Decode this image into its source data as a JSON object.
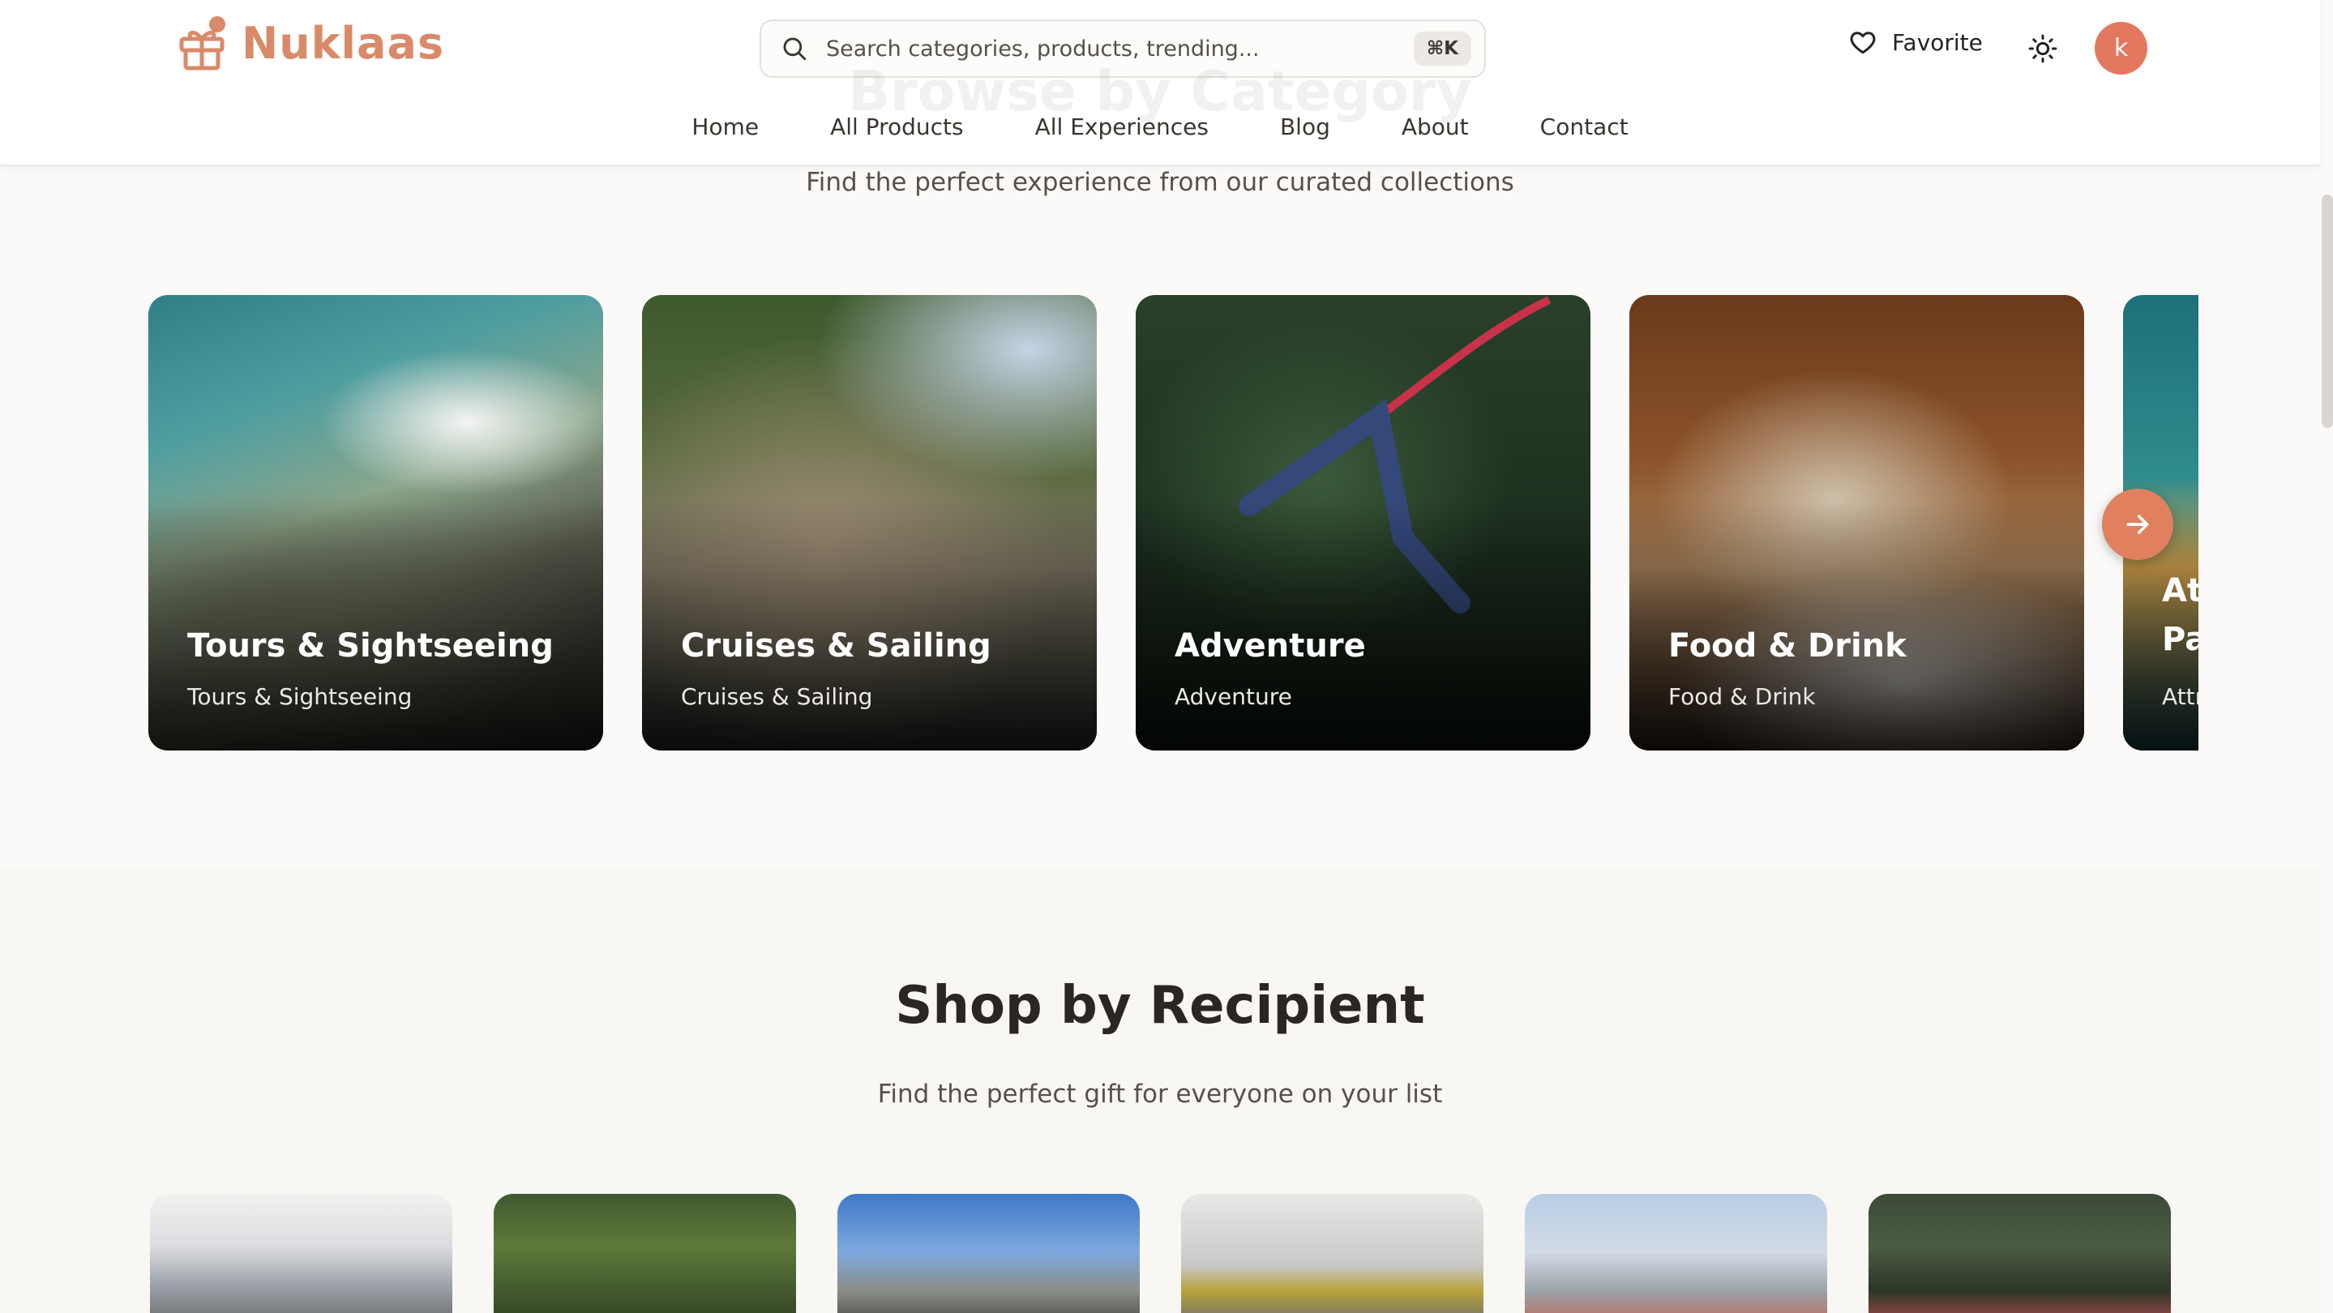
{
  "header": {
    "brand": "Nuklaas",
    "search_placeholder": "Search categories, products, trending...",
    "search_shortcut": "⌘K",
    "favorite_label": "Favorite",
    "avatar_initial": "k",
    "nav": [
      "Home",
      "All Products",
      "All Experiences",
      "Blog",
      "About",
      "Contact"
    ]
  },
  "categories_section": {
    "heading_partial": "Browse by Category",
    "subtitle": "Find the perfect experience from our curated collections",
    "cards": [
      {
        "title": "Tours & Sightseeing",
        "subtitle": "Tours & Sightseeing",
        "image": "helicopter-cockpit-over-coast"
      },
      {
        "title": "Cruises & Sailing",
        "subtitle": "Cruises & Sailing",
        "image": "limestone-cliffs-with-boat"
      },
      {
        "title": "Adventure",
        "subtitle": "Adventure",
        "image": "bungee-jump-in-forest"
      },
      {
        "title": "Food & Drink",
        "subtitle": "Food & Drink",
        "image": "restaurant-table-wine-glass"
      },
      {
        "title": "At",
        "title2": "Pa",
        "subtitle": "Attr",
        "image": "attractions-partial"
      }
    ]
  },
  "recipient_section": {
    "title": "Shop by Recipient",
    "subtitle": "Find the perfect gift for everyone on your list",
    "cards": [
      "snowy-mountain-rope",
      "forest-greenery",
      "mountain-lake-sky",
      "cyclist-grey-sky",
      "zipline-sky",
      "forest-people"
    ]
  },
  "colors": {
    "brand": "#d98a68",
    "accent_button": "#e0805f",
    "avatar": "#e3785f",
    "background": "#fbfaf8"
  }
}
